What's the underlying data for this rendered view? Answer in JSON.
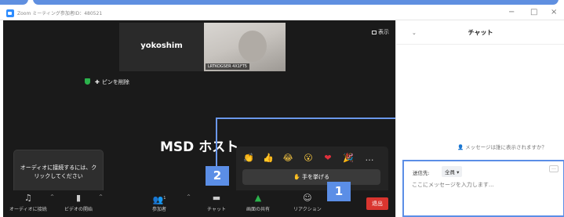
{
  "window": {
    "title": "Zoom ミーティング参加者ID：480521",
    "controls": {
      "minimize": "−",
      "maximize": "□",
      "close": "×"
    }
  },
  "video": {
    "participant_name": "yokoshim",
    "photo_caption": "LRTKOGSER 4X1FT5",
    "view_label": "表示",
    "unpin_label": "ピンを削除",
    "host_label": "MSD ホスト"
  },
  "tooltip": {
    "line1": "オーディオに接続するには、ク",
    "line2": "リックしてください"
  },
  "reactions": {
    "emojis": [
      "👏",
      "👍",
      "😂",
      "😮",
      "❤",
      "🎉",
      "…"
    ],
    "raise_hand_label": "手を挙げる"
  },
  "toolbar": {
    "audio": "オーディオに接続",
    "video": "ビデオの開始",
    "participants": "参加者",
    "participants_count": "1",
    "chat": "チャット",
    "share": "画面の共有",
    "reactions": "リアクション",
    "leave": "退出"
  },
  "badges": {
    "one": "1",
    "two": "2"
  },
  "chat": {
    "title": "チャット",
    "prompt": "メッセージは誰に表示されますか？",
    "send_to_label": "送信先:",
    "send_to_value": "全員",
    "more": "…",
    "input_placeholder": "ここにメッセージを入力します..."
  },
  "colors": {
    "accent_blue": "#5b8ee6",
    "leave_red": "#d9352f",
    "share_green": "#2bb24c"
  }
}
